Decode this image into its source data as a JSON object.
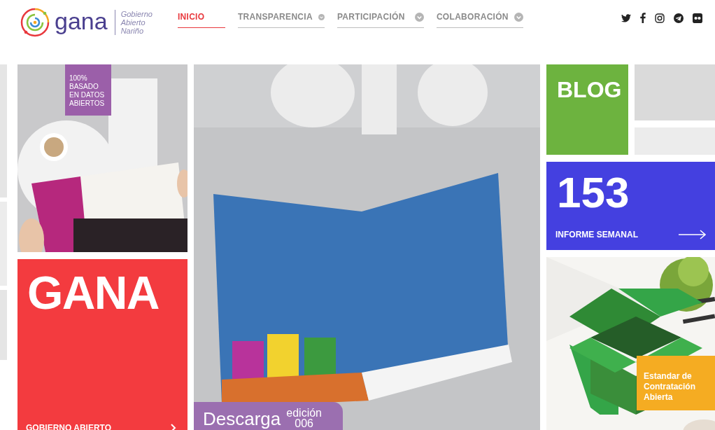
{
  "header": {
    "logo_text": "gana",
    "tagline": [
      "Gobierno",
      "Abierto",
      "Nariño"
    ]
  },
  "nav": [
    {
      "label": "INICIO",
      "selected": true,
      "kind": "link"
    },
    {
      "label": "TRANSPARENCIA",
      "selected": false,
      "kind": "dropdown"
    },
    {
      "label": "PARTICIPACIÓN",
      "selected": false,
      "kind": "dropdown"
    },
    {
      "label": "COLABORACIÓN",
      "selected": false,
      "kind": "dropdown"
    }
  ],
  "social": [
    {
      "kind": "twitter"
    },
    {
      "kind": "facebook"
    },
    {
      "kind": "instagram"
    },
    {
      "kind": "telegram"
    },
    {
      "kind": "flickr"
    }
  ],
  "tiles": {
    "dato": {
      "badge": "100% BASADO EN DATOS ABIERTOS"
    },
    "gana": {
      "title": "GANA",
      "footer": "GOBIERNO ABIERTO"
    },
    "edition": {
      "action": "Descarga",
      "label": "edición",
      "number": "006"
    },
    "blog": {
      "title": "BLOG"
    },
    "report": {
      "number": "153",
      "label": "INFORME SEMANAL"
    },
    "ocds": {
      "label": "Estandar de Contratación Abierta"
    }
  }
}
